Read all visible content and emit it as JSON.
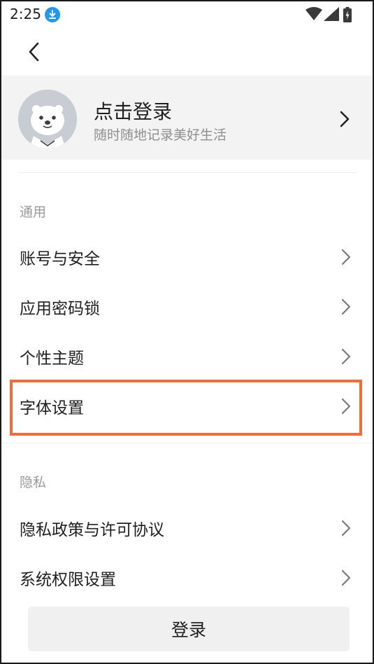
{
  "status_bar": {
    "time": "2:25",
    "icons": [
      "download-icon",
      "wifi-icon",
      "signal-icon",
      "battery-icon"
    ]
  },
  "nav": {
    "back_icon": "back-chevron-icon"
  },
  "profile": {
    "title": "点击登录",
    "subtitle": "随时随地记录美好生活"
  },
  "sections": {
    "general": {
      "label": "通用",
      "items": [
        {
          "label": "账号与安全"
        },
        {
          "label": "应用密码锁"
        },
        {
          "label": "个性主题"
        },
        {
          "label": "字体设置"
        }
      ]
    },
    "privacy": {
      "label": "隐私",
      "items": [
        {
          "label": "隐私政策与许可协议"
        },
        {
          "label": "系统权限设置"
        }
      ]
    }
  },
  "login_button": {
    "label": "登录"
  },
  "colors": {
    "highlight": "#f26b3a",
    "download_badge": "#2196f3",
    "profile_bg": "#f3f3f3"
  }
}
